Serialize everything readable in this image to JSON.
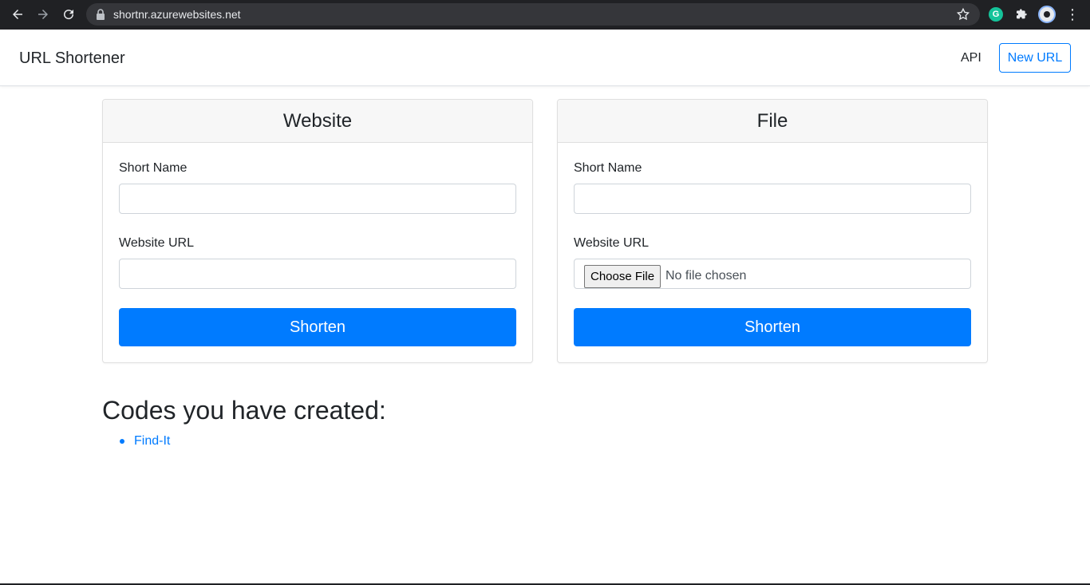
{
  "browser": {
    "url": "shortnr.azurewebsites.net",
    "icons": [
      "back-icon",
      "forward-icon",
      "reload-icon",
      "lock-icon",
      "star-icon",
      "grammarly-icon",
      "puzzle-icon",
      "profile-icon",
      "menu-icon"
    ],
    "grammarly_letter": "G",
    "menu_glyph": "⋮"
  },
  "navbar": {
    "brand": "URL Shortener",
    "api_link": "API",
    "new_url_button": "New URL",
    "accent_color": "#007bff"
  },
  "website_card": {
    "title": "Website",
    "short_name_label": "Short Name",
    "short_name_value": "",
    "url_label": "Website URL",
    "url_value": "",
    "submit_label": "Shorten"
  },
  "file_card": {
    "title": "File",
    "short_name_label": "Short Name",
    "short_name_value": "",
    "url_label": "Website URL",
    "choose_file_label": "Choose File",
    "file_status": "No file chosen",
    "submit_label": "Shorten"
  },
  "codes": {
    "heading": "Codes you have created:",
    "items": [
      {
        "label": "Find-It"
      }
    ]
  }
}
